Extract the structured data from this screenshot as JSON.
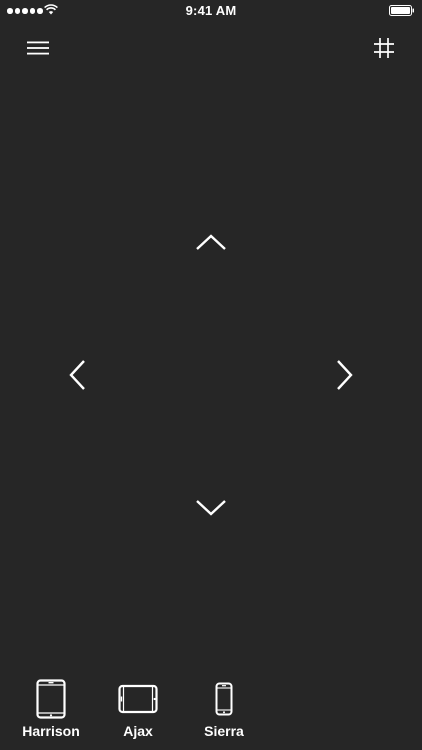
{
  "status_bar": {
    "time": "9:41 AM",
    "signal_icon": "signal-dots-icon",
    "wifi_icon": "wifi-icon",
    "battery_icon": "battery-icon"
  },
  "header": {
    "menu_icon": "hamburger-menu-icon",
    "grid_icon": "hash-grid-icon"
  },
  "controls": {
    "up_icon": "chevron-up-icon",
    "down_icon": "chevron-down-icon",
    "left_icon": "chevron-left-icon",
    "right_icon": "chevron-right-icon"
  },
  "devices": [
    {
      "label": "Harrison",
      "icon": "tablet-portrait-icon"
    },
    {
      "label": "Ajax",
      "icon": "tablet-landscape-icon"
    },
    {
      "label": "Sierra",
      "icon": "phone-icon"
    }
  ],
  "colors": {
    "background": "#262626",
    "foreground": "#ffffff"
  }
}
